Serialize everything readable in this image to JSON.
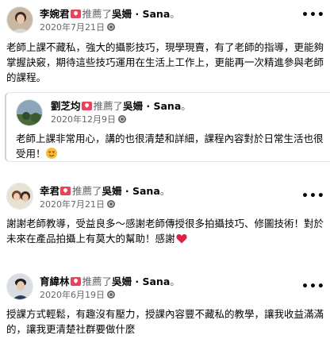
{
  "posts": [
    {
      "author": "李婉君",
      "recommended_text": "推薦了",
      "page": "吳姍 · Sana",
      "date": "2020年7月21日",
      "more_label": "•••",
      "body": "老師上課不藏私，強大的攝影技巧，現學現賣，有了老師的指導，更能夠掌握訣竅，期待這些技巧運用在生活上工作上，更能再一次精進參與老師的課程。"
    },
    {
      "author": "劉芝均",
      "recommended_text": "推薦了",
      "page": "吳姍 · Sana",
      "date": "2020年12月9日",
      "body": "老師上課非常用心，講的也很清楚和詳細，課程內容對於日常生活也很受用！"
    },
    {
      "author": "幸君",
      "recommended_text": "推薦了",
      "page": "吳姍 · Sana",
      "date": "2020年7月21日",
      "more_label": "•••",
      "body": "謝謝老師教導，受益良多～感謝老師傳授很多拍攝技巧、修圖技術！對於未來在產品拍攝上有莫大的幫助！感謝"
    },
    {
      "author": "育緯林",
      "recommended_text": "推薦了",
      "page": "吳姍 · Sana",
      "date": "2020年6月19日",
      "more_label": "•••",
      "body": "授課方式輕鬆，有趣沒有壓力，授課內容豐不藏私的教學，讓我收益滿滿的，讓我更清楚社群要做什麼"
    }
  ],
  "separator": "。",
  "colors": {
    "recommend_badge": "#f33e58",
    "meta": "#65676b",
    "heart": "#e41e3f"
  }
}
